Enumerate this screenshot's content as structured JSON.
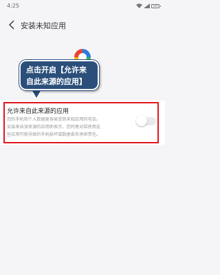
{
  "status_bar": {
    "time": "4:25",
    "battery": "100"
  },
  "header": {
    "title": "安装未知应用"
  },
  "tooltip": {
    "line1": "点击开启【允许来",
    "line2": "自此来源的应用】"
  },
  "setting": {
    "title": "允许来自此来源的应用",
    "description_lines": [
      "您的手机和个人数据更容易受到未知应用的攻击。",
      "安装来自该来源的应用即表示，您同意对因使用这",
      "些应用可能导致的手机损坏或数据丢失承担责任。"
    ],
    "toggle_state": "off"
  },
  "colors": {
    "highlight_border": "#e0161b",
    "tooltip_bg": "#2b4f7a",
    "background": "#f5f5f7"
  }
}
